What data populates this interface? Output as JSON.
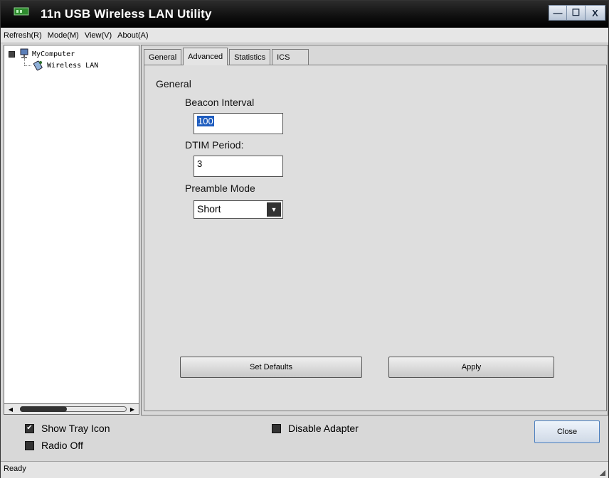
{
  "window": {
    "title": "11n USB Wireless LAN Utility",
    "buttons": {
      "minimize": "—",
      "maximize": "☐",
      "close": "X"
    }
  },
  "menu": [
    {
      "label": "Refresh(R)"
    },
    {
      "label": "Mode(M)"
    },
    {
      "label": "View(V)"
    },
    {
      "label": "About(A)"
    }
  ],
  "tree": {
    "root": "MyComputer",
    "child": "Wireless LAN"
  },
  "tabs": [
    {
      "label": "General"
    },
    {
      "label": "Advanced",
      "active": true
    },
    {
      "label": "Statistics"
    },
    {
      "label": "ICS"
    }
  ],
  "advanced": {
    "section_label": "General",
    "beacon_interval": {
      "label": "Beacon Interval",
      "value": "100"
    },
    "dtim_period": {
      "label": "DTIM Period:",
      "value": "3"
    },
    "preamble_mode": {
      "label": "Preamble Mode",
      "value": "Short"
    },
    "set_defaults_label": "Set Defaults",
    "apply_label": "Apply"
  },
  "options": {
    "show_tray_icon": {
      "label": "Show Tray Icon",
      "checked": true
    },
    "radio_off": {
      "label": "Radio Off",
      "checked": false
    },
    "disable_adapter": {
      "label": "Disable Adapter",
      "checked": false
    }
  },
  "close_label": "Close",
  "status": "Ready"
}
